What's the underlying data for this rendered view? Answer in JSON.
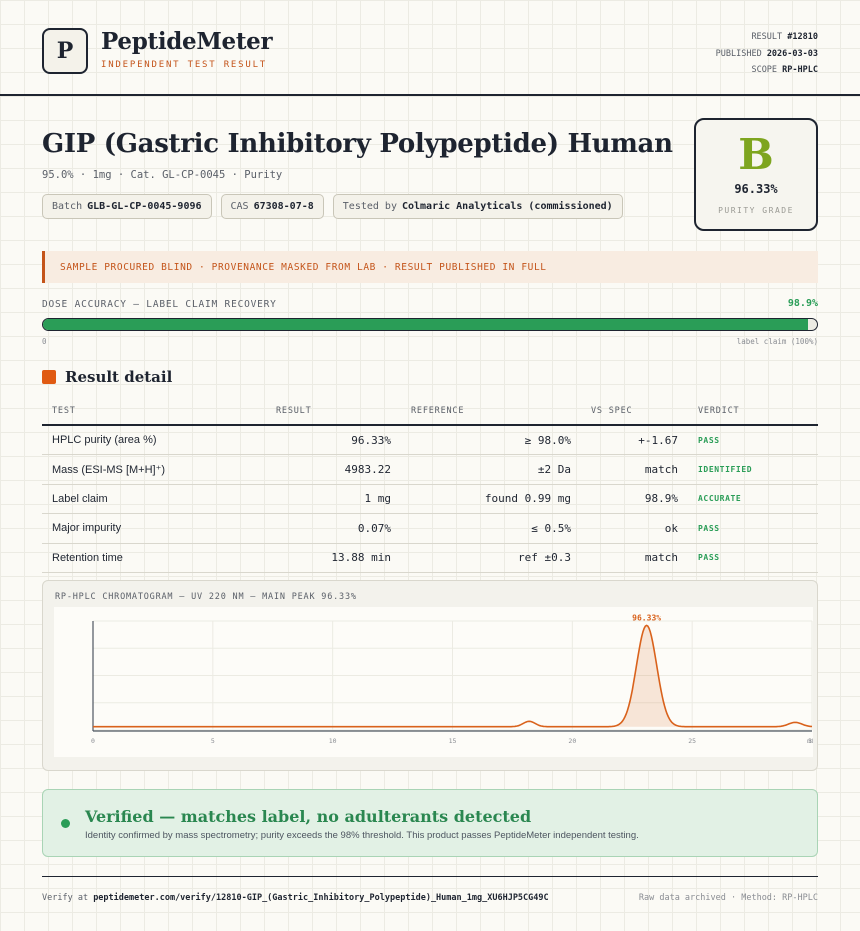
{
  "header": {
    "logo_letter": "P",
    "brand": "PeptideMeter",
    "tagline": "INDEPENDENT TEST RESULT",
    "result_label": "RESULT",
    "result_value": "#12810",
    "published_label": "PUBLISHED",
    "published_value": "2026-03-03",
    "scope_label": "SCOPE",
    "scope_value": "RP-HPLC"
  },
  "product": {
    "title": "GIP (Gastric Inhibitory Polypeptide) Human",
    "subline": "95.0% · 1mg · Cat. GL-CP-0045 · Purity",
    "batch_label": "Batch",
    "batch_value": "GLB-GL-CP-0045-9096",
    "cas_label": "CAS",
    "cas_value": "67308-07-8",
    "tested_label": "Tested by",
    "tested_value": "Colmaric Analyticals (commissioned)"
  },
  "grade": {
    "letter": "B",
    "value": "96.33%",
    "label": "PURITY GRADE",
    "color": "#7ea51f"
  },
  "notice": "SAMPLE PROCURED BLIND · PROVENANCE MASKED FROM LAB · RESULT PUBLISHED IN FULL",
  "dose": {
    "label": "DOSE ACCURACY — LABEL CLAIM RECOVERY",
    "value": "98.9%",
    "fraction": 0.989,
    "min_label": "0",
    "max_label": "label claim (100%)"
  },
  "results": {
    "title": "Result detail",
    "columns": [
      "TEST",
      "RESULT",
      "REFERENCE",
      "VS SPEC",
      "VERDICT"
    ],
    "rows": [
      {
        "test": "HPLC purity (area %)",
        "result": "96.33%",
        "reference": "≥ 98.0%",
        "vs_spec": "+-1.67",
        "verdict": "PASS"
      },
      {
        "test": "Mass (ESI-MS [M+H]⁺)",
        "result": "4983.22",
        "reference": "±2 Da",
        "vs_spec": "match",
        "verdict": "IDENTIFIED"
      },
      {
        "test": "Label claim",
        "result": "1 mg",
        "reference": "found 0.99 mg",
        "vs_spec": "98.9%",
        "verdict": "ACCURATE"
      },
      {
        "test": "Major impurity",
        "result": "0.07%",
        "reference": "≤ 0.5%",
        "vs_spec": "ok",
        "verdict": "PASS"
      },
      {
        "test": "Retention time",
        "result": "13.88 min",
        "reference": "ref ±0.3",
        "vs_spec": "match",
        "verdict": "PASS"
      }
    ]
  },
  "chart_data": {
    "type": "line",
    "title": "RP-HPLC CHROMATOGRAM — UV 220 NM — MAIN PEAK 96.33%",
    "x_ticks": [
      "0",
      "5",
      "10",
      "15",
      "20",
      "25",
      "30",
      "min"
    ],
    "xlim": [
      0,
      30
    ],
    "peak_label": "96.33%",
    "baseline": 0.03,
    "peaks": [
      {
        "x": 18.2,
        "height": 0.05,
        "width": 0.25
      },
      {
        "x": 23.1,
        "height": 0.93,
        "width": 0.42
      },
      {
        "x": 29.3,
        "height": 0.04,
        "width": 0.28
      }
    ],
    "color": "#d9621c"
  },
  "verified": {
    "title": "Verified — matches label, no adulterants detected",
    "description": "Identity confirmed by mass spectrometry; purity exceeds the 98% threshold. This product passes PeptideMeter independent testing."
  },
  "footer": {
    "verify_prefix": "Verify at",
    "verify_url": "peptidemeter.com/verify/12810-GIP_(Gastric_Inhibitory_Polypeptide)_Human_1mg_XU6HJP5CG49C",
    "right": "Raw data archived · Method: RP-HPLC"
  }
}
